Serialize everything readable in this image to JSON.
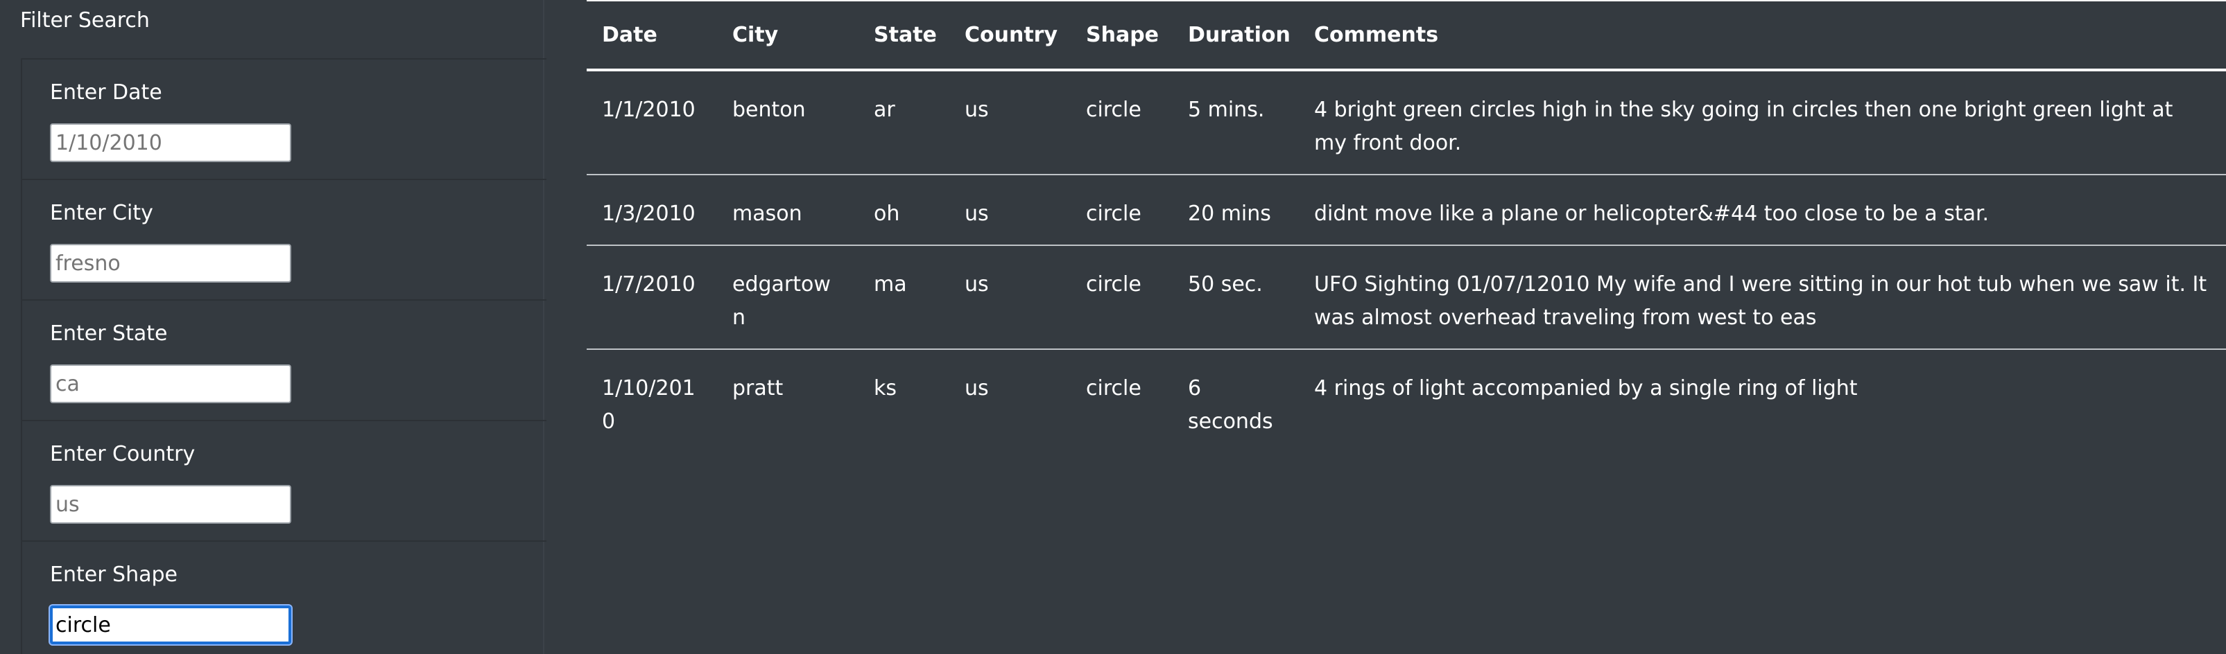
{
  "sidebar": {
    "title": "Filter Search",
    "filters": [
      {
        "label": "Enter Date",
        "placeholder": "1/10/2010",
        "value": ""
      },
      {
        "label": "Enter City",
        "placeholder": "fresno",
        "value": ""
      },
      {
        "label": "Enter State",
        "placeholder": "ca",
        "value": ""
      },
      {
        "label": "Enter Country",
        "placeholder": "us",
        "value": ""
      },
      {
        "label": "Enter Shape",
        "placeholder": "",
        "value": "circle"
      }
    ]
  },
  "table": {
    "headers": [
      "Date",
      "City",
      "State",
      "Country",
      "Shape",
      "Duration",
      "Comments"
    ],
    "rows": [
      [
        "1/1/2010",
        "benton",
        "ar",
        "us",
        "circle",
        "5 mins.",
        "4 bright green circles high in the sky going in circles then one bright green light at my front door."
      ],
      [
        "1/3/2010",
        "mason",
        "oh",
        "us",
        "circle",
        "20 mins",
        "didnt move like a plane or helicopter&#44 too close to be a star."
      ],
      [
        "1/7/2010",
        "edgartown",
        "ma",
        "us",
        "circle",
        "50 sec.",
        "UFO Sighting 01/07/12010 My wife and I were sitting in our hot tub when we saw it. It was almost overhead traveling from west to eas"
      ],
      [
        "1/10/2010",
        "pratt",
        "ks",
        "us",
        "circle",
        "6 seconds",
        "4 rings of light accompanied by a single ring of light"
      ]
    ]
  },
  "colors": {
    "background": "#343a40",
    "text": "#ffffff",
    "focus_border": "#1a6fd6"
  }
}
